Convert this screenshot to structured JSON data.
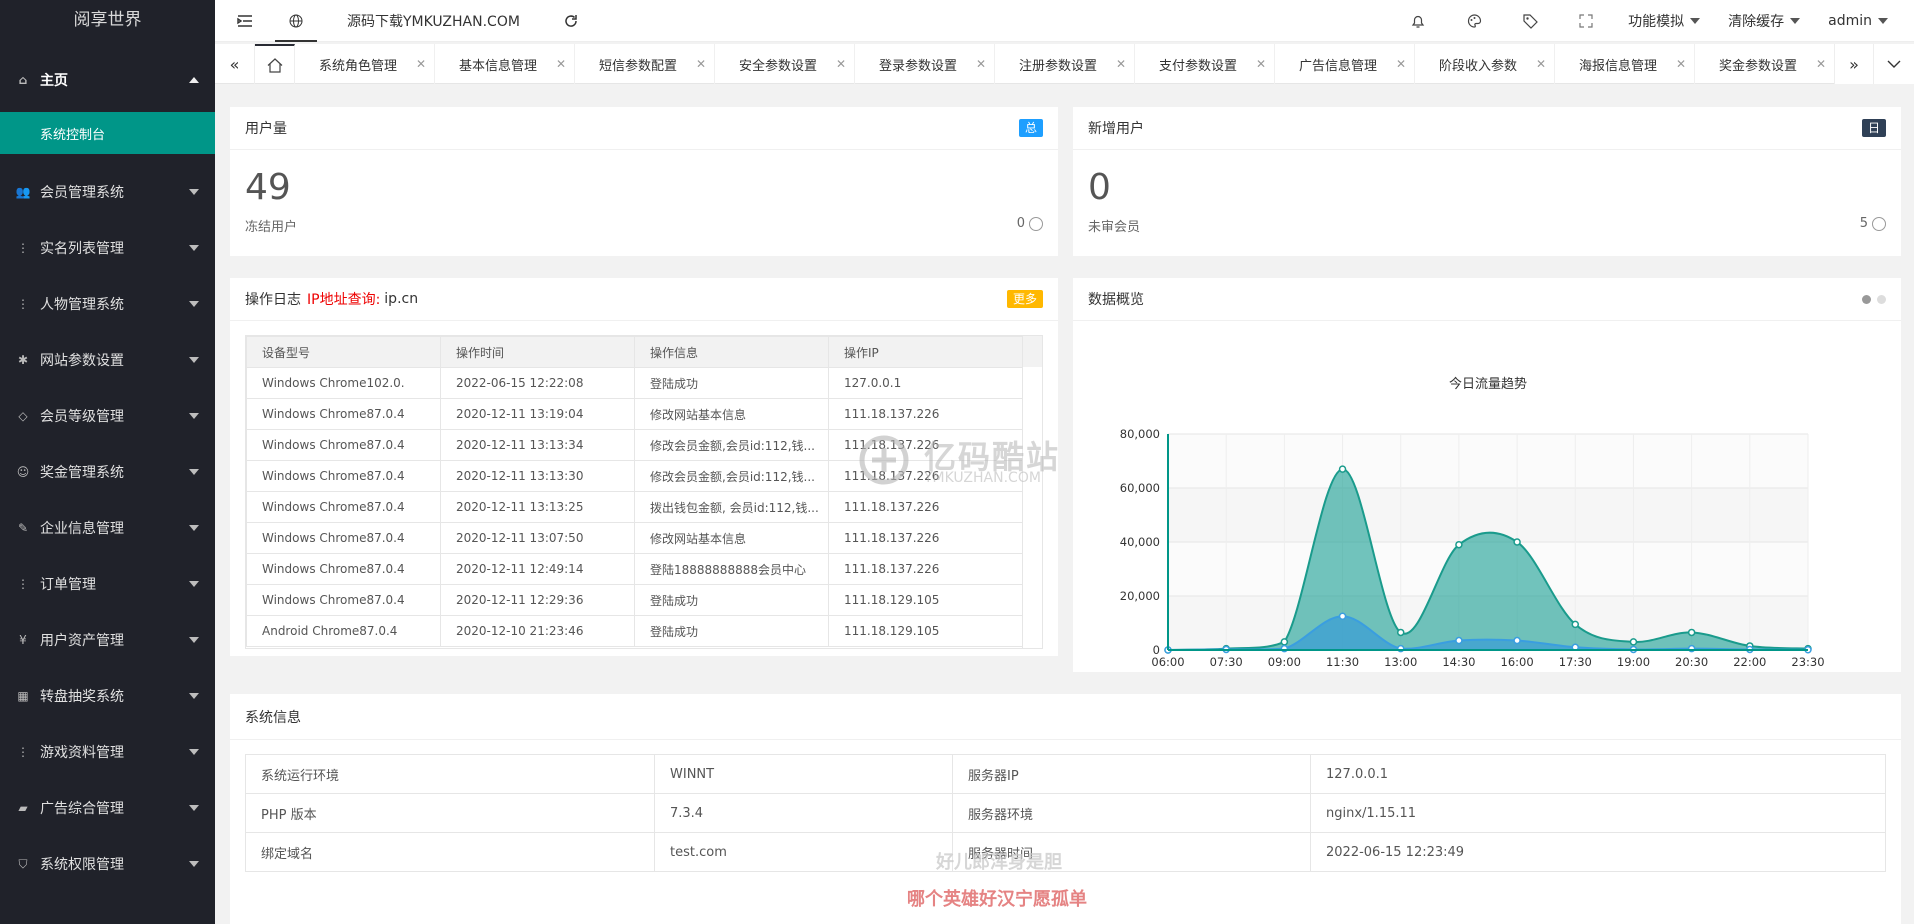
{
  "app": {
    "logo": "阅享世界"
  },
  "sidebar": {
    "home": "主页",
    "active_sub": "系统控制台",
    "items": [
      {
        "label": "会员管理系统",
        "icon": "users-icon",
        "glyph": "👥"
      },
      {
        "label": "实名列表管理",
        "icon": "more-vertical-icon",
        "glyph": "⋮"
      },
      {
        "label": "人物管理系统",
        "icon": "more-vertical-icon",
        "glyph": "⋮"
      },
      {
        "label": "网站参数设置",
        "icon": "gear-icon",
        "glyph": "✱"
      },
      {
        "label": "会员等级管理",
        "icon": "diamond-icon",
        "glyph": "◇"
      },
      {
        "label": "奖金管理系统",
        "icon": "smile-icon",
        "glyph": "☺"
      },
      {
        "label": "企业信息管理",
        "icon": "edit-icon",
        "glyph": "✎"
      },
      {
        "label": "订单管理",
        "icon": "more-vertical-icon",
        "glyph": "⋮"
      },
      {
        "label": "用户资产管理",
        "icon": "yen-icon",
        "glyph": "¥"
      },
      {
        "label": "转盘抽奖系统",
        "icon": "apps-icon",
        "glyph": "▦"
      },
      {
        "label": "游戏资料管理",
        "icon": "more-vertical-icon",
        "glyph": "⋮"
      },
      {
        "label": "广告综合管理",
        "icon": "speaker-icon",
        "glyph": "▰"
      },
      {
        "label": "系统权限管理",
        "icon": "shield-icon",
        "glyph": "⛉"
      }
    ]
  },
  "header": {
    "site_link": "源码下载YMKUZHAN.COM",
    "menu_simulate": "功能模拟",
    "clear_cache": "清除缓存",
    "user": "admin"
  },
  "tabs": [
    "系统角色管理",
    "基本信息管理",
    "短信参数配置",
    "安全参数设置",
    "登录参数设置",
    "注册参数设置",
    "支付参数设置",
    "广告信息管理",
    "阶段收入参数",
    "海报信息管理",
    "奖金参数设置"
  ],
  "user_card": {
    "title": "用户量",
    "badge": "总",
    "value": "49",
    "foot_label": "冻结用户",
    "foot_value": "0"
  },
  "new_user_card": {
    "title": "新增用户",
    "badge": "日",
    "value": "0",
    "foot_label": "未审会员",
    "foot_value": "5"
  },
  "log": {
    "title": "操作日志",
    "ip_query_label": "IP地址查询:",
    "ip_query_site": "ip.cn",
    "more": "更多",
    "columns": [
      "设备型号",
      "操作时间",
      "操作信息",
      "操作IP"
    ],
    "rows": [
      [
        "Windows Chrome102.0.",
        "2022-06-15 12:22:08",
        "登陆成功",
        "127.0.0.1"
      ],
      [
        "Windows Chrome87.0.4",
        "2020-12-11 13:19:04",
        "修改网站基本信息",
        "111.18.137.226"
      ],
      [
        "Windows Chrome87.0.4",
        "2020-12-11 13:13:34",
        "修改会员金额,会员id:112,钱...",
        "111.18.137.226"
      ],
      [
        "Windows Chrome87.0.4",
        "2020-12-11 13:13:30",
        "修改会员金额,会员id:112,钱...",
        "111.18.137.226"
      ],
      [
        "Windows Chrome87.0.4",
        "2020-12-11 13:13:25",
        "拨出钱包金额, 会员id:112,钱...",
        "111.18.137.226"
      ],
      [
        "Windows Chrome87.0.4",
        "2020-12-11 13:07:50",
        "修改网站基本信息",
        "111.18.137.226"
      ],
      [
        "Windows Chrome87.0.4",
        "2020-12-11 12:49:14",
        "登陆18888888888会员中心",
        "111.18.137.226"
      ],
      [
        "Windows Chrome87.0.4",
        "2020-12-11 12:29:36",
        "登陆成功",
        "111.18.129.105"
      ],
      [
        "Android Chrome87.0.4",
        "2020-12-10 21:23:46",
        "登陆成功",
        "111.18.129.105"
      ]
    ]
  },
  "overview": {
    "title": "数据概览"
  },
  "chart_data": {
    "type": "area",
    "title": "今日流量趋势",
    "x": [
      "06:00",
      "07:30",
      "09:00",
      "11:30",
      "13:00",
      "14:30",
      "16:00",
      "17:30",
      "19:00",
      "20:30",
      "22:00",
      "23:30"
    ],
    "ylim": [
      0,
      80000
    ],
    "yticks": [
      "0",
      "20,000",
      "40,000",
      "60,000",
      "80,000"
    ],
    "series": [
      {
        "values": [
          0,
          500,
          3000,
          67000,
          6500,
          39000,
          40000,
          9500,
          3000,
          6500,
          1500,
          500
        ],
        "color": "#2ec7c9"
      },
      {
        "values": [
          0,
          200,
          500,
          12500,
          500,
          3500,
          3500,
          1000,
          200,
          500,
          200,
          100
        ],
        "color": "#5ab1ef"
      }
    ],
    "grid": true
  },
  "sysinfo": {
    "title": "系统信息",
    "rows": [
      [
        "系统运行环境",
        "WINNT",
        "服务器IP",
        "127.0.0.1"
      ],
      [
        "PHP 版本",
        "7.3.4",
        "服务器环境",
        "nginx/1.15.11"
      ],
      [
        "绑定域名",
        "test.com",
        "服务器时间",
        "2022-06-15 12:23:49"
      ]
    ]
  },
  "watermarks": {
    "brand": "亿码酷站",
    "brand_url": "YMKUZHAN.COM",
    "line1": "好儿郎浑身是胆",
    "line2": "哪个英雄好汉宁愿孤单"
  }
}
